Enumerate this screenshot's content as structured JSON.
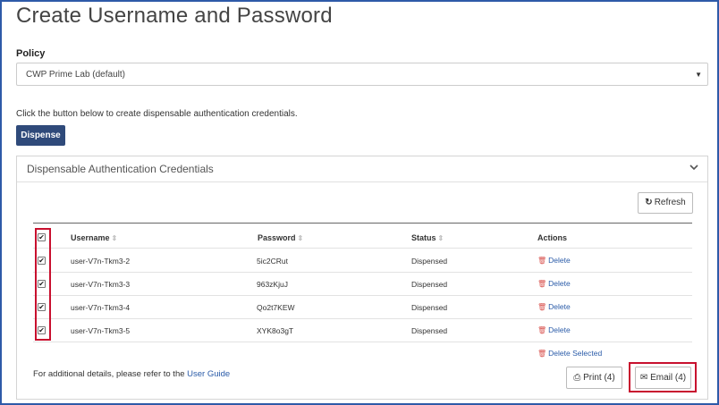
{
  "page": {
    "title": "Create Username and Password"
  },
  "policy": {
    "label": "Policy",
    "selected": "CWP Prime Lab (default)",
    "caret": "▼"
  },
  "instructions": "Click the button below to create dispensable authentication credentials.",
  "dispense_label": "Dispense",
  "panel": {
    "title": "Dispensable Authentication Credentials",
    "refresh_label": "Refresh",
    "refresh_icon": "↻",
    "columns": {
      "username": "Username",
      "password": "Password",
      "status": "Status",
      "actions": "Actions"
    },
    "sort_icon": "⇕",
    "rows": [
      {
        "username": "user-V7n-Tkm3-2",
        "password": "5ic2CRut",
        "status": "Dispensed",
        "action": "Delete"
      },
      {
        "username": "user-V7n-Tkm3-3",
        "password": "963zKjuJ",
        "status": "Dispensed",
        "action": "Delete"
      },
      {
        "username": "user-V7n-Tkm3-4",
        "password": "Qo2t7KEW",
        "status": "Dispensed",
        "action": "Delete"
      },
      {
        "username": "user-V7n-Tkm3-5",
        "password": "XYK8o3gT",
        "status": "Dispensed",
        "action": "Delete"
      }
    ],
    "check_mark": "✔",
    "delete_selected": "Delete Selected",
    "trash_icon": "🗑",
    "footer_text": "For additional details, please refer to the",
    "footer_link": "User Guide",
    "print_label": "Print (4)",
    "print_icon": "⎙",
    "email_label": "Email (4)",
    "email_icon": "✉"
  },
  "colors": {
    "frame": "#2e5aa8",
    "dispense_bg": "#2f4a7a",
    "link": "#2a5ba8",
    "highlight": "#c8102e",
    "trash": "#d9534f"
  }
}
